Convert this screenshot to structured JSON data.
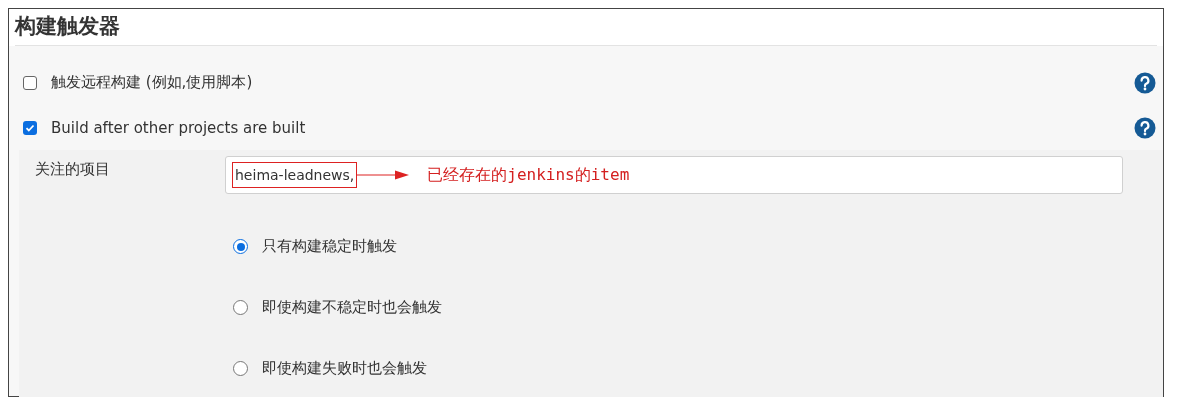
{
  "section": {
    "title": "构建触发器"
  },
  "triggers": [
    {
      "label": "触发远程构建 (例如,使用脚本)",
      "checked": false
    },
    {
      "label": "Build after other projects are built",
      "checked": true
    }
  ],
  "watch": {
    "label": "关注的项目",
    "value": "heima-leadnews,",
    "annotation": "已经存在的jenkins的item"
  },
  "conditions": [
    {
      "label": "只有构建稳定时触发",
      "selected": true
    },
    {
      "label": "即使构建不稳定时也会触发",
      "selected": false
    },
    {
      "label": "即使构建失败时也会触发",
      "selected": false
    }
  ]
}
